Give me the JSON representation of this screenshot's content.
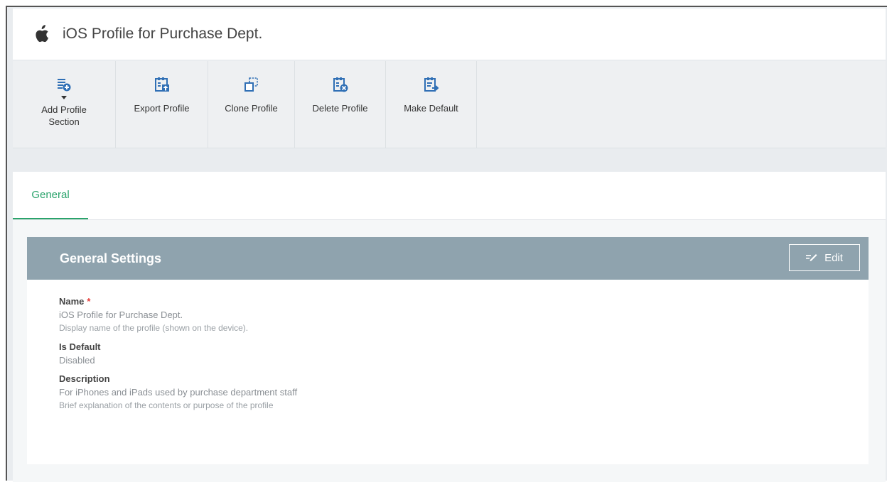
{
  "header": {
    "title": "iOS Profile for Purchase Dept.",
    "icon": "apple-icon"
  },
  "toolbar": {
    "items": [
      {
        "label": "Add Profile Section",
        "label_line1": "Add Profile",
        "label_line2": "Section",
        "icon": "add-section-icon"
      },
      {
        "label": "Export Profile",
        "icon": "export-icon"
      },
      {
        "label": "Clone Profile",
        "icon": "clone-icon"
      },
      {
        "label": "Delete Profile",
        "icon": "delete-icon"
      },
      {
        "label": "Make Default",
        "icon": "make-default-icon"
      }
    ]
  },
  "tabs": [
    {
      "label": "General",
      "active": true
    }
  ],
  "panel": {
    "title": "General Settings",
    "edit_label": "Edit",
    "fields": [
      {
        "label": "Name",
        "required_mark": "*",
        "value": "iOS Profile for Purchase Dept.",
        "help": "Display name of the profile (shown on the device)."
      },
      {
        "label": "Is Default",
        "value": "Disabled"
      },
      {
        "label": "Description",
        "value": "For iPhones and iPads used by purchase department staff",
        "help": "Brief explanation of the contents or purpose of the profile"
      }
    ]
  },
  "colors": {
    "accent": "#2aa36b",
    "panel_header": "#8fa3ae",
    "required": "#e53935",
    "icon_blue": "#2f6fb5"
  }
}
